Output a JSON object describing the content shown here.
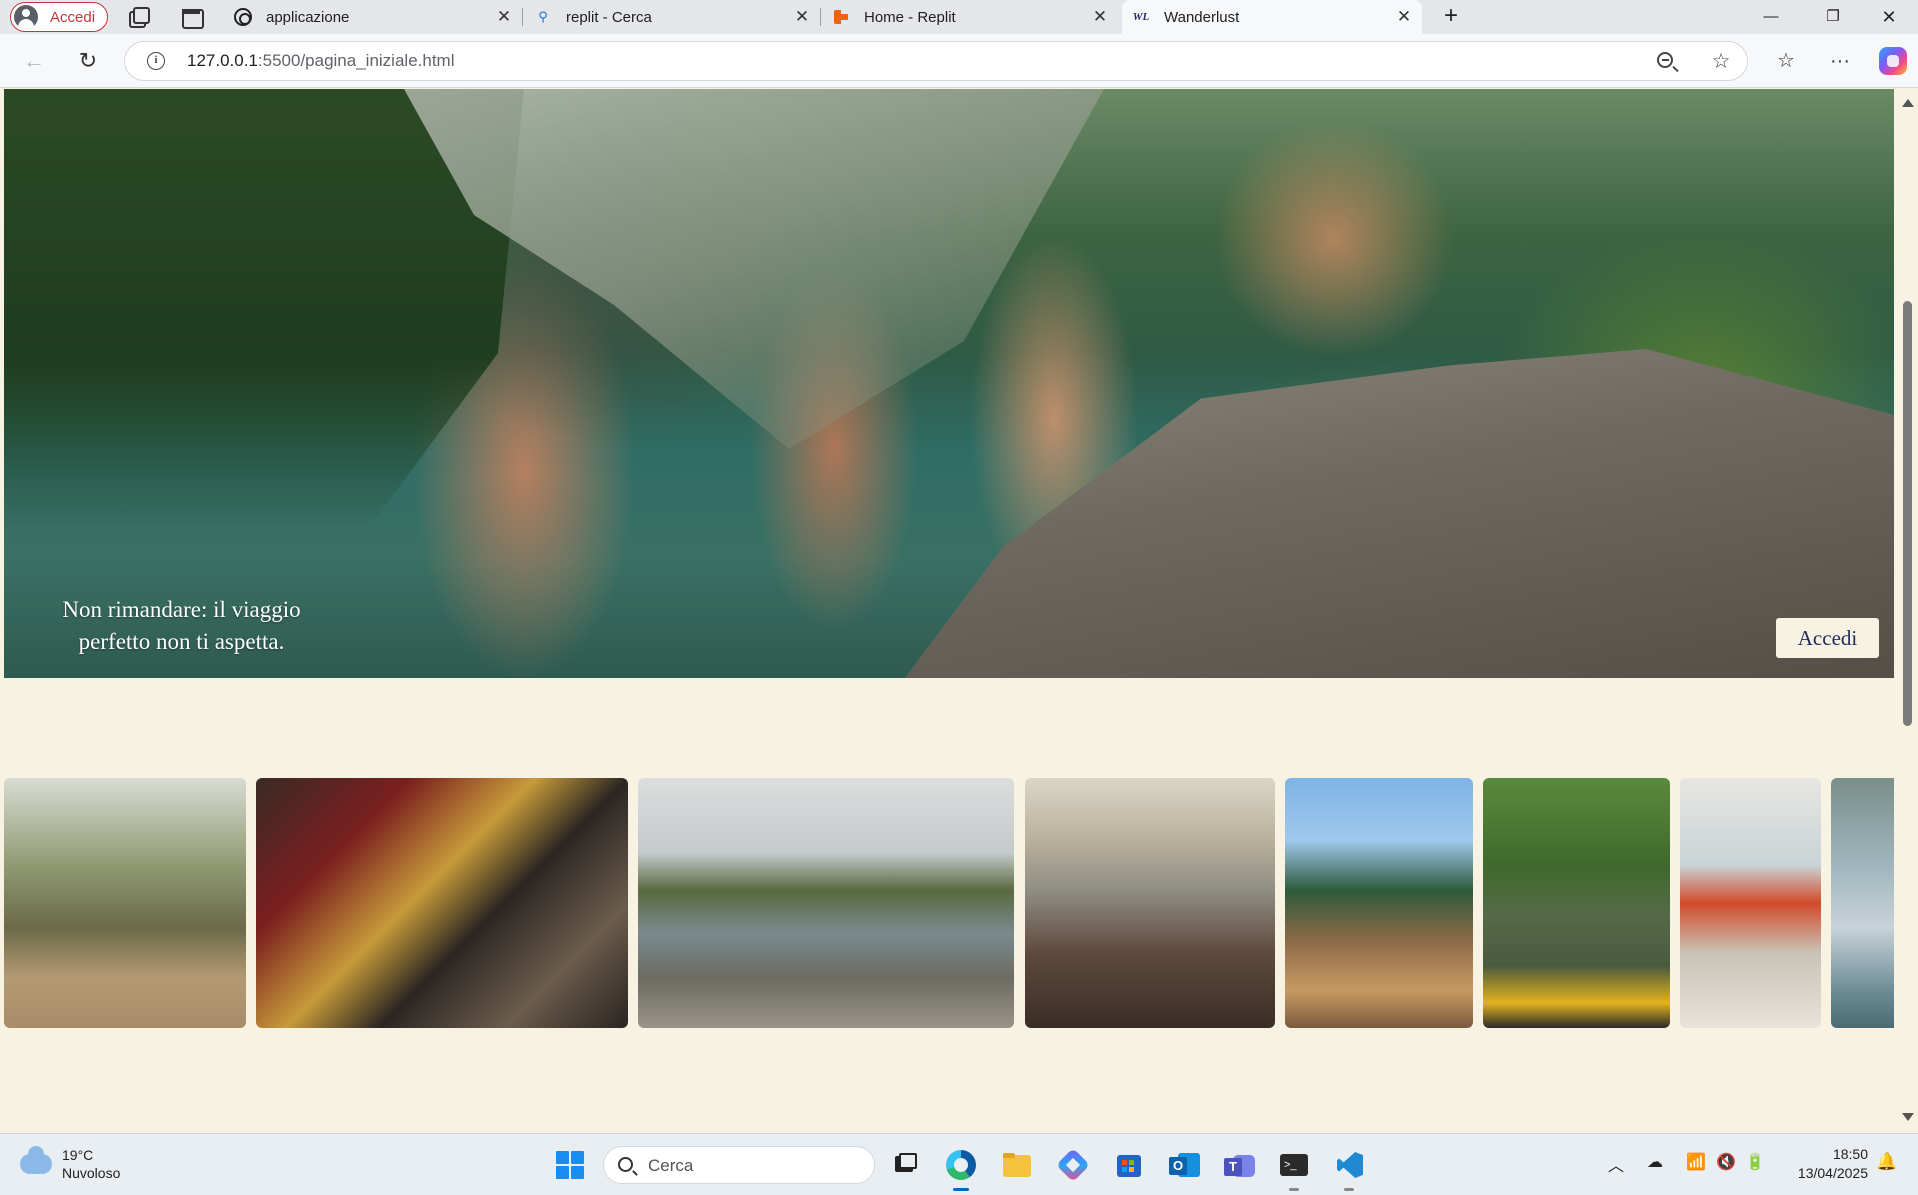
{
  "browser": {
    "profile_label": "Accedi",
    "tabs": [
      {
        "title": "applicazione",
        "icon": "openai-icon"
      },
      {
        "title": "replit - Cerca",
        "icon": "search-icon"
      },
      {
        "title": "Home - Replit",
        "icon": "replit-icon"
      },
      {
        "title": "Wanderlust",
        "icon": "wanderlust-icon",
        "active": true
      }
    ],
    "favicon_wl": "WL",
    "url_host": "127.0.0.1",
    "url_path": ":5500/pagina_iniziale.html"
  },
  "page": {
    "hero_caption": "Non rimandare: il viaggio perfetto non ti aspetta.",
    "login_button": "Accedi",
    "background_color": "#f7f2e2",
    "gallery": [
      "hammocks-under-tree-photo",
      "street-food-market-photo",
      "lakeside-friends-photo",
      "cliff-sunset-photo",
      "sailboat-guitar-photo",
      "kayak-river-photo",
      "beach-red-dress-photo",
      "lake-swim-photo"
    ]
  },
  "taskbar": {
    "weather_temp": "19°C",
    "weather_desc": "Nuvoloso",
    "search_placeholder": "Cerca",
    "time": "18:50",
    "date": "13/04/2025"
  }
}
